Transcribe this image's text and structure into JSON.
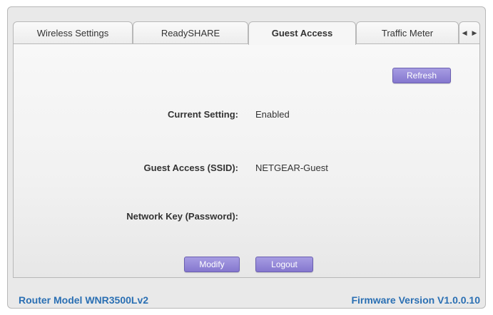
{
  "tabs": [
    {
      "label": "Wireless Settings",
      "active": false
    },
    {
      "label": "ReadySHARE",
      "active": false
    },
    {
      "label": "Guest Access",
      "active": true
    },
    {
      "label": "Traffic Meter",
      "active": false
    }
  ],
  "tab_scroll": {
    "prev_glyph": "◀",
    "next_glyph": "▶"
  },
  "panel": {
    "refresh_label": "Refresh",
    "current_setting_label": "Current Setting:",
    "current_setting_value": "Enabled",
    "ssid_label": "Guest Access (SSID):",
    "ssid_value": "NETGEAR-Guest",
    "password_label": "Network Key (Password):",
    "password_value": "",
    "modify_label": "Modify",
    "logout_label": "Logout"
  },
  "footer": {
    "model": "Router Model WNR3500Lv2",
    "firmware": "Firmware Version V1.0.0.10"
  },
  "colors": {
    "accent_button": "#8e81d6",
    "footer_text": "#2a6fb3"
  }
}
